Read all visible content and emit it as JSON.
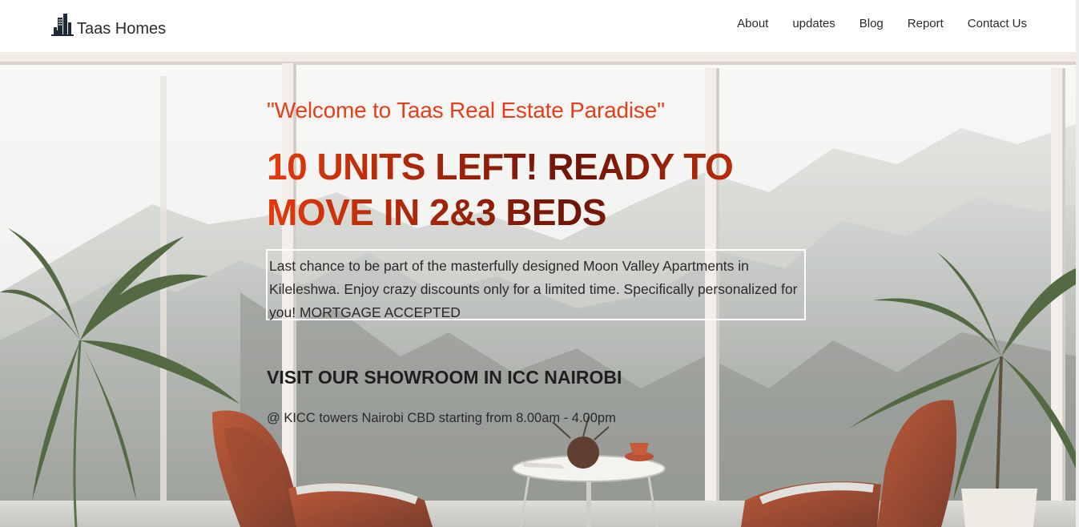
{
  "navbar": {
    "brand": {
      "name": "Taas Homes",
      "logo_icon": "city-skyline-icon"
    },
    "links": [
      {
        "label": "About"
      },
      {
        "label": "updates"
      },
      {
        "label": "Blog"
      },
      {
        "label": "Report"
      },
      {
        "label": "Contact Us"
      }
    ]
  },
  "hero": {
    "welcome": "\"Welcome to Taas Real Estate Paradise\"",
    "headline": "10 UNITS LEFT! READY TO MOVE IN 2&3 BEDS",
    "description": "Last chance to be part of the masterfully designed Moon Valley Apartments in Kileleshwa. Enjoy crazy discounts only for a limited time. Specifically personalized for you! MORTGAGE ACCEPTED",
    "showroom_heading": "VISIT OUR SHOWROOM IN ICC NAIROBI",
    "showroom_hours": "@ KICC towers Nairobi CBD starting from 8.00am - 4.00pm"
  },
  "colors": {
    "accent": "#e2401b",
    "headline_dark": "#6e1407",
    "text": "#2a2a2a"
  }
}
